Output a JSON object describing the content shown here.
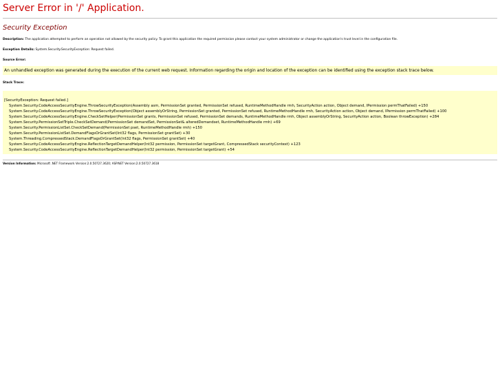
{
  "header": {
    "title": "Server Error in '/' Application."
  },
  "exception": {
    "title": "Security Exception"
  },
  "description": {
    "label": "Description:",
    "text_before": " The application attempted to perform an operation not allowed by the security policy.  To grant this application the required permission please contact your system administrator or change the application's trust level in the configuration file."
  },
  "details": {
    "label": "Exception Details:",
    "text": " System.Security.SecurityException: Request failed."
  },
  "source_error": {
    "label": "Source Error:",
    "message": "An unhandled exception was generated during the execution of the current web request. Information regarding the origin and location of the exception can be identified using the exception stack trace below."
  },
  "stack_trace": {
    "label": "Stack Trace:",
    "header": "[SecurityException: Request failed.]",
    "lines": [
      "System.Security.CodeAccessSecurityEngine.ThrowSecurityException(Assembly asm, PermissionSet granted, PermissionSet refused, RuntimeMethodHandle rmh, SecurityAction action, Object demand, IPermission permThatFailed) +150",
      "System.Security.CodeAccessSecurityEngine.ThrowSecurityException(Object assemblyOrString, PermissionSet granted, PermissionSet refused, RuntimeMethodHandle rmh, SecurityAction action, Object demand, IPermission permThatFailed) +100",
      "System.Security.CodeAccessSecurityEngine.CheckSetHelper(PermissionSet grants, PermissionSet refused, PermissionSet demands, RuntimeMethodHandle rmh, Object assemblyOrString, SecurityAction action, Boolean throwException) +284",
      "System.Security.PermissionSetTriple.CheckSetDemand(PermissionSet demandSet, PermissionSet& alteredDemandset, RuntimeMethodHandle rmh) +69",
      "System.Security.PermissionListSet.CheckSetDemand(PermissionSet pset, RuntimeMethodHandle rmh) +150",
      "System.Security.PermissionListSet.DemandFlagsOrGrantSet(Int32 flags, PermissionSet grantSet) +30",
      "System.Threading.CompressedStack.DemandFlagsOrGrantSet(Int32 flags, PermissionSet grantSet) +40",
      "System.Security.CodeAccessSecurityEngine.ReflectionTargetDemandHelper(Int32 permission, PermissionSet targetGrant, CompressedStack securityContext) +123",
      "System.Security.CodeAccessSecurityEngine.ReflectionTargetDemandHelper(Int32 permission, PermissionSet targetGrant) +54"
    ]
  },
  "version": {
    "label": "Version Information:",
    "text": " Microsoft .NET Framework Version:2.0.50727.3620; ASP.NET Version:2.0.50727.3618"
  }
}
